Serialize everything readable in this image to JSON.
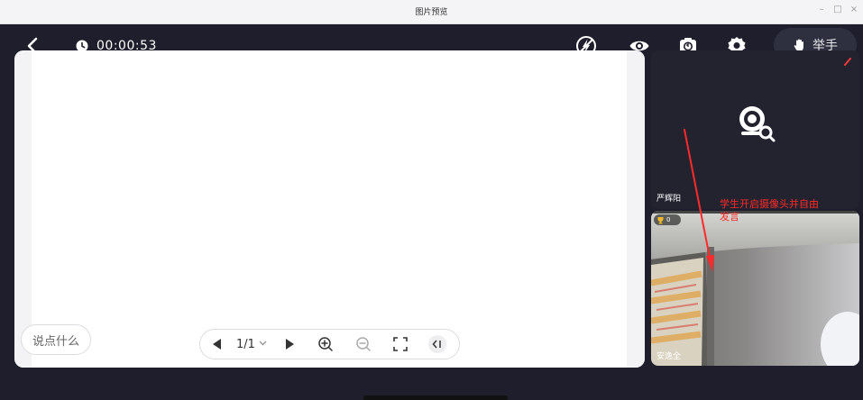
{
  "os_window": {
    "title": "图片预览",
    "minimize": "–",
    "maximize": "□",
    "close": "×"
  },
  "toolbar": {
    "back_icon": "chevron-left-icon",
    "timer": "00:00:53",
    "raise_hand_label": "举手",
    "icons": [
      "lightning-off-icon",
      "eye-icon",
      "camera-switch-icon",
      "gear-icon",
      "hand-icon"
    ]
  },
  "board": {
    "chat_placeholder": "说点什么",
    "page_indicator": "1/1",
    "page_dropdown_icon": "chevron-down-icon",
    "controls": [
      "prev-page-icon",
      "next-page-icon",
      "zoom-in-icon",
      "zoom-out-icon",
      "fullscreen-icon",
      "collapse-icon"
    ]
  },
  "videos": {
    "teacher": {
      "name": "严辉阳",
      "placeholder_icon": "webcam-search-icon"
    },
    "student": {
      "name": "安逸全",
      "trophy_count": "0"
    }
  },
  "annotation": {
    "text_line1": "学生开启摄像头并自由",
    "text_line2": "发言",
    "color": "#ff2a2a"
  },
  "colors": {
    "app_background": "#1e1e2c",
    "accent_red": "#ff2a2a",
    "trophy_gold": "#f2b72b"
  }
}
